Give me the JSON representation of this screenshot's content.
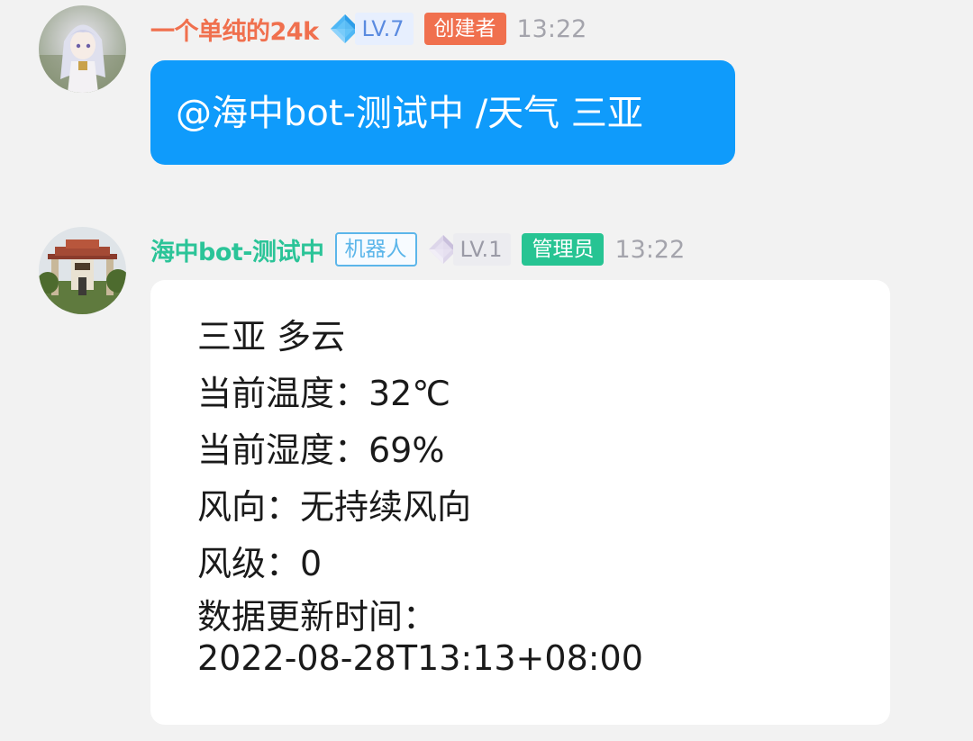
{
  "messages": [
    {
      "sender": {
        "name": "一个单纯的24k",
        "level": "LV.7",
        "level_icon": "blue-diamond-icon",
        "role": "创建者",
        "name_color": "#f0704e"
      },
      "time": "13:22",
      "text": "@海中bot-测试中 /天气 三亚",
      "bubble_color": "#0f9bfb"
    },
    {
      "sender": {
        "name": "海中bot-测试中",
        "bot_tag": "机器人",
        "level": "LV.1",
        "level_icon": "grey-diamond-icon",
        "role": "管理员",
        "name_color": "#2bc498"
      },
      "time": "13:22",
      "lines": [
        "三亚 多云",
        "当前温度：32℃",
        "当前湿度：69%",
        "风向：无持续风向",
        "风级：0",
        "数据更新时间：",
        "2022-08-28T13:13+08:00"
      ],
      "bubble_color": "#ffffff"
    }
  ]
}
